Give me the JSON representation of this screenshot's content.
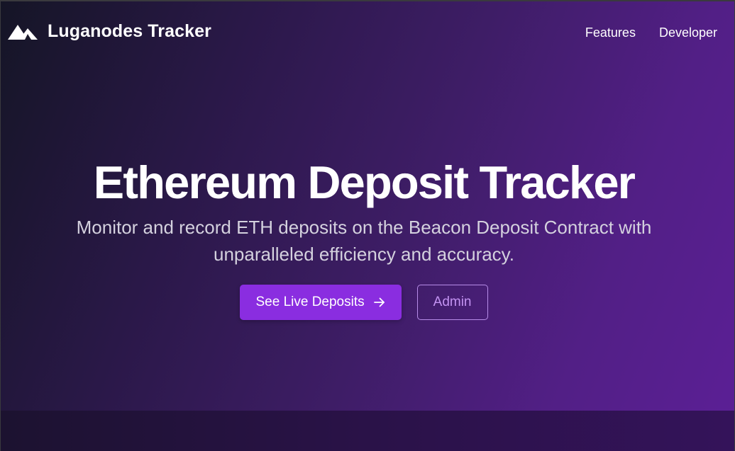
{
  "navbar": {
    "brand_name": "Luganodes Tracker",
    "logo_icon": "mountain-logo-icon",
    "links": [
      {
        "label": "Features"
      },
      {
        "label": "Developer"
      }
    ]
  },
  "hero": {
    "title": "Ethereum Deposit Tracker",
    "subtitle": "Monitor and record ETH deposits on the Beacon Deposit Contract with unparalleled efficiency and accuracy.",
    "primary_button": {
      "label": "See Live Deposits",
      "icon": "arrow-right-icon"
    },
    "secondary_button": {
      "label": "Admin"
    }
  },
  "colors": {
    "accent": "#8a2de0",
    "outline": "#b78ce8",
    "background_start": "#151526",
    "background_end": "#5b1f95"
  }
}
